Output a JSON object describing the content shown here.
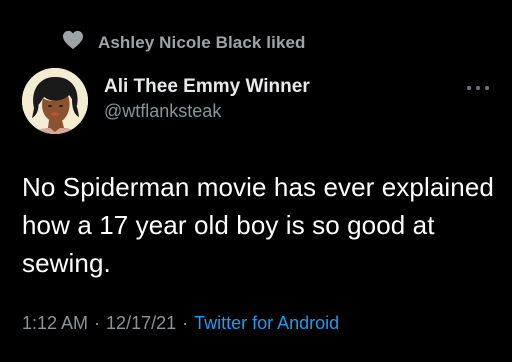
{
  "social_context": {
    "icon": "heart-icon",
    "text": "Ashley Nicole Black liked"
  },
  "author": {
    "avatar": "avatar-illustration",
    "display_name": "Ali Thee Emmy Winner",
    "handle": "@wtflanksteak"
  },
  "more_menu": {
    "icon": "more-options-icon"
  },
  "tweet": {
    "text": "No Spiderman movie has ever explained how a 17 year old boy is so good at sewing."
  },
  "meta": {
    "time": "1:12 AM",
    "date": "12/17/21",
    "separator": "·",
    "source": "Twitter for Android"
  },
  "colors": {
    "background": "#000000",
    "primary_text": "#e7e9ea",
    "secondary_text": "#8b949a",
    "accent": "#1d9bf0"
  }
}
